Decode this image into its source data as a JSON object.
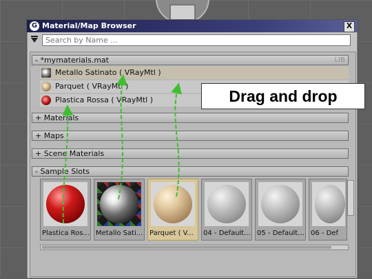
{
  "window": {
    "title": "Material/Map Browser",
    "close_label": "X"
  },
  "search": {
    "placeholder": "Search by Name ..."
  },
  "library": {
    "header": "- *mymaterials.mat",
    "tag": "LIB",
    "items": [
      {
        "label": "Metallo Satinato  ( VRayMtl )",
        "icon": "metal-sphere-icon"
      },
      {
        "label": "Parquet  ( VRayMtl )",
        "icon": "wood-sphere-icon"
      },
      {
        "label": "Plastica Rossa  ( VRayMtl )",
        "icon": "red-sphere-icon"
      }
    ]
  },
  "groups": [
    {
      "label": "+ Materials"
    },
    {
      "label": "+ Maps"
    },
    {
      "label": "+ Scene Materials"
    },
    {
      "label": "- Sample Slots"
    }
  ],
  "slots": [
    {
      "label": "Plastica Ros..."
    },
    {
      "label": "Metallo Sati..."
    },
    {
      "label": "Parquet  ( V..."
    },
    {
      "label": "04 - Default..."
    },
    {
      "label": "05 - Default..."
    },
    {
      "label": "06 - Def"
    }
  ],
  "callout": {
    "text": "Drag and drop"
  },
  "colors": {
    "arrow": "#3fbf2f",
    "selected_slot": "#d8c79a"
  }
}
